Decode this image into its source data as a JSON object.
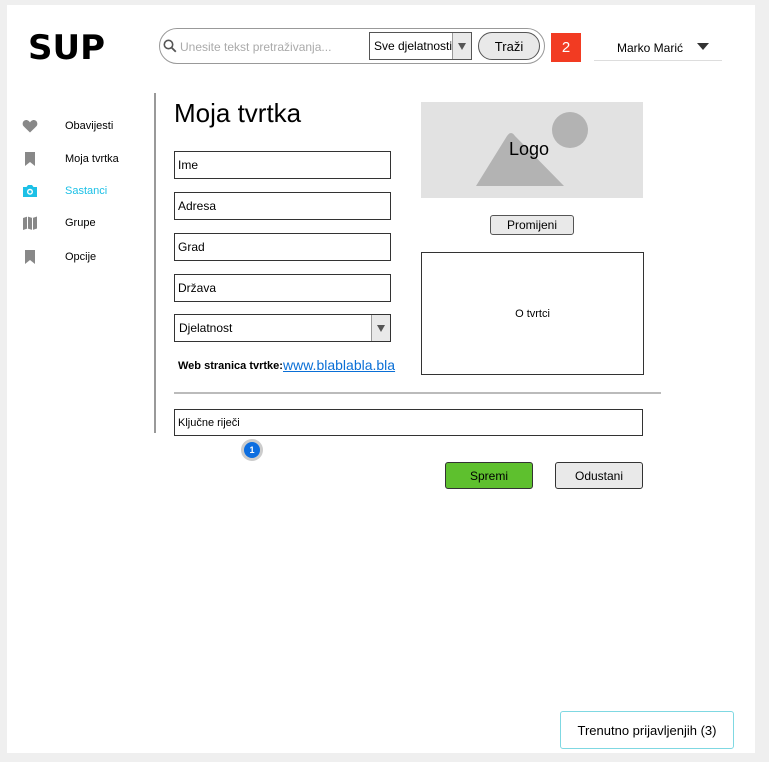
{
  "app": {
    "logo": "SUP"
  },
  "header": {
    "search_placeholder": "Unesite tekst pretraživanja...",
    "category_select": "Sve djelatnosti",
    "search_button": "Traži",
    "notification_count": "2",
    "user_name": "Marko Marić"
  },
  "sidebar": {
    "items": [
      {
        "label": "Obavijesti",
        "icon": "heart-icon",
        "active": false
      },
      {
        "label": "Moja tvrtka",
        "icon": "bookmark-icon",
        "active": false
      },
      {
        "label": "Sastanci",
        "icon": "camera-icon",
        "active": true
      },
      {
        "label": "Grupe",
        "icon": "map-icon",
        "active": false
      },
      {
        "label": "Opcije",
        "icon": "bookmark-icon",
        "active": false
      }
    ]
  },
  "main": {
    "title": "Moja tvrtka",
    "fields": {
      "name": "Ime",
      "address": "Adresa",
      "city": "Grad",
      "country": "Država",
      "activity": "Djelatnost"
    },
    "website_label": "Web stranica tvrtke:",
    "website_link": "www.blablabla.bla",
    "logo_label": "Logo",
    "change_button": "Promijeni",
    "about_label": "O tvrtci",
    "keywords": "Ključne riječi",
    "marker_number": "1",
    "save_button": "Spremi",
    "cancel_button": "Odustani"
  },
  "footer": {
    "online_users": "Trenutno prijavljenjih (3)"
  },
  "colors": {
    "active": "#1cc0e6",
    "save": "#5ec02e",
    "badge": "#f23b22",
    "link": "#0a6fd6"
  }
}
